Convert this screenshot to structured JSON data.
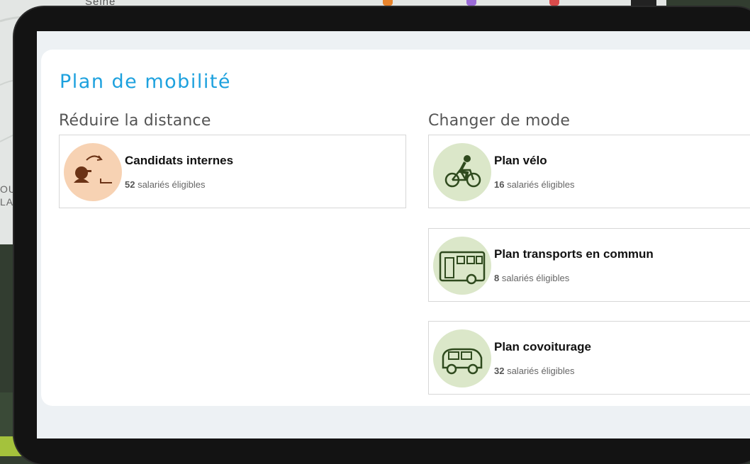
{
  "colors": {
    "title": "#1da1de",
    "internal_icon_bg": "#f7d2b3",
    "internal_icon_fg": "#6b3316",
    "mode_icon_bg": "#dbe7c9",
    "mode_icon_fg": "#2f4a1e"
  },
  "background": {
    "map_label": "Seine",
    "map_side_letters": "OU LA"
  },
  "page": {
    "title": "Plan de mobilité"
  },
  "sections": {
    "reduce": {
      "title": "Réduire la distance",
      "plans": [
        {
          "name": "Candidats internes",
          "count": "52",
          "suffix": " salariés éligibles",
          "icon": "person-relocation-icon"
        }
      ]
    },
    "mode": {
      "title": "Changer de mode",
      "plans": [
        {
          "name": "Plan vélo",
          "count": "16",
          "suffix": " salariés éligibles",
          "icon": "bicycle-icon"
        },
        {
          "name": "Plan transports en commun",
          "count": "8",
          "suffix": " salariés éligibles",
          "icon": "bus-icon"
        },
        {
          "name": "Plan covoiturage",
          "count": "32",
          "suffix": " salariés éligibles",
          "icon": "car-icon"
        }
      ]
    }
  }
}
